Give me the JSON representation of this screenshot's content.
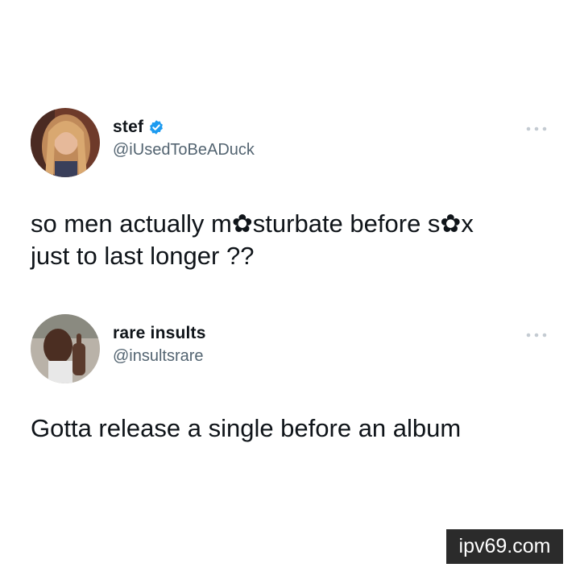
{
  "tweets": [
    {
      "display_name": "stef",
      "verified": true,
      "handle": "@iUsedToBeADuck",
      "text": "so men actually m✿sturbate before s✿x\njust to last longer ??",
      "avatar_icon": "profile-photo-woman",
      "more_icon": "more-horizontal-icon"
    },
    {
      "display_name": "rare insults",
      "verified": false,
      "handle": "@insultsrare",
      "text": "Gotta release a single before an album",
      "avatar_icon": "profile-photo-man",
      "more_icon": "more-horizontal-icon"
    }
  ],
  "watermark": {
    "text": "ipv69.com"
  },
  "colors": {
    "background": "#ffffff",
    "text": "#0f1419",
    "secondary_text": "#536471",
    "verified_badge": "#1d9bf0",
    "watermark_bg": "#2b2b2b"
  }
}
